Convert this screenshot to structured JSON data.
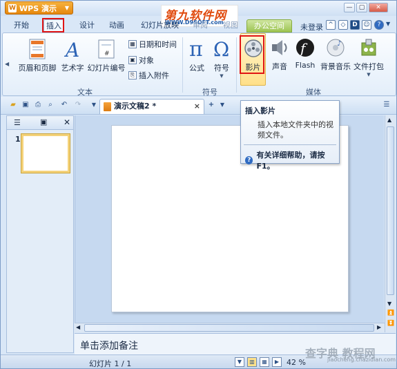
{
  "app": {
    "name": "WPS 演示",
    "logo_text": "W"
  },
  "watermark": {
    "main": "第九软件网",
    "sub": "WWW.D9SOFT.com",
    "corner": "查字典 教程网",
    "corner_url": "jiaocheng.chazidian.com"
  },
  "tabs": [
    "开始",
    "插入",
    "设计",
    "动画",
    "幻灯片放映",
    "审阅",
    "视图"
  ],
  "office_tab": "办公空间",
  "login": "未登录",
  "ribbon": {
    "text_group": {
      "label": "文本",
      "buttons": [
        "页眉和页脚",
        "艺术字",
        "幻灯片编号"
      ],
      "small": [
        "日期和时间",
        "对象",
        "插入附件"
      ]
    },
    "symbol_group": {
      "label": "符号",
      "buttons": [
        "公式",
        "符号"
      ]
    },
    "media_group": {
      "label": "媒体",
      "buttons": [
        "影片",
        "声音",
        "Flash",
        "背景音乐",
        "文件打包"
      ]
    }
  },
  "document_tab": "演示文稿2 *",
  "tooltip": {
    "title": "插入影片",
    "desc": "插入本地文件夹中的视频文件。",
    "help": "有关详细帮助，请按F1。"
  },
  "slides": {
    "number": "1"
  },
  "notes_placeholder": "单击添加备注",
  "status": {
    "slide_info": "幻灯片 1 / 1",
    "zoom": "42 %"
  },
  "colors": {
    "accent": "#e6870d",
    "highlight_box": "#e01414",
    "ribbon_bg": "#e3eefa"
  }
}
